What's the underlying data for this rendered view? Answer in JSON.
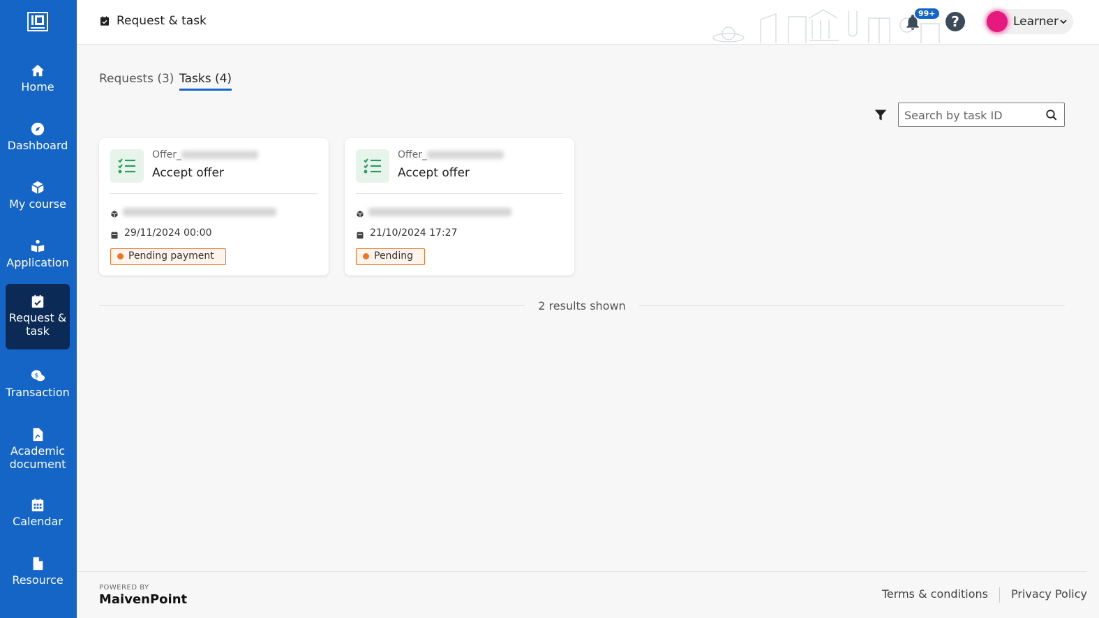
{
  "app": {
    "brand_logo": "IPI",
    "accent": "#1565c7"
  },
  "sidebar": {
    "items": [
      {
        "label": "Home",
        "icon": "home-icon"
      },
      {
        "label": "Dashboard",
        "icon": "compass-icon"
      },
      {
        "label": "My course",
        "icon": "cube-icon"
      },
      {
        "label": "Application",
        "icon": "reader-icon"
      },
      {
        "label": "Request & task",
        "icon": "calendar-check-icon",
        "active": true
      },
      {
        "label": "Transaction",
        "icon": "money-chat-icon"
      },
      {
        "label": "Academic document",
        "icon": "pdf-file-icon"
      },
      {
        "label": "Calendar",
        "icon": "calendar-icon"
      },
      {
        "label": "Resource",
        "icon": "file-icon"
      }
    ]
  },
  "header": {
    "title": "Request & task",
    "notifications_badge": "99+",
    "help_label": "?",
    "user_name": "Learner"
  },
  "tabs": [
    {
      "label": "Requests (3)"
    },
    {
      "label": "Tasks (4)",
      "active": true
    }
  ],
  "search": {
    "placeholder": "Search by task ID",
    "value": ""
  },
  "tasks": [
    {
      "offer_prefix": "Offer_",
      "title": "Accept offer",
      "date": "29/11/2024 00:00",
      "status": "Pending payment",
      "status_color": "#e8772e"
    },
    {
      "offer_prefix": "Offer_",
      "title": "Accept offer",
      "date": "21/10/2024 17:27",
      "status": "Pending",
      "status_color": "#e8772e"
    }
  ],
  "results_text": "2 results shown",
  "footer": {
    "powered_by": "POWERED BY",
    "brand": "MaivenPoint",
    "links": [
      "Terms & conditions",
      "Privacy Policy"
    ]
  }
}
